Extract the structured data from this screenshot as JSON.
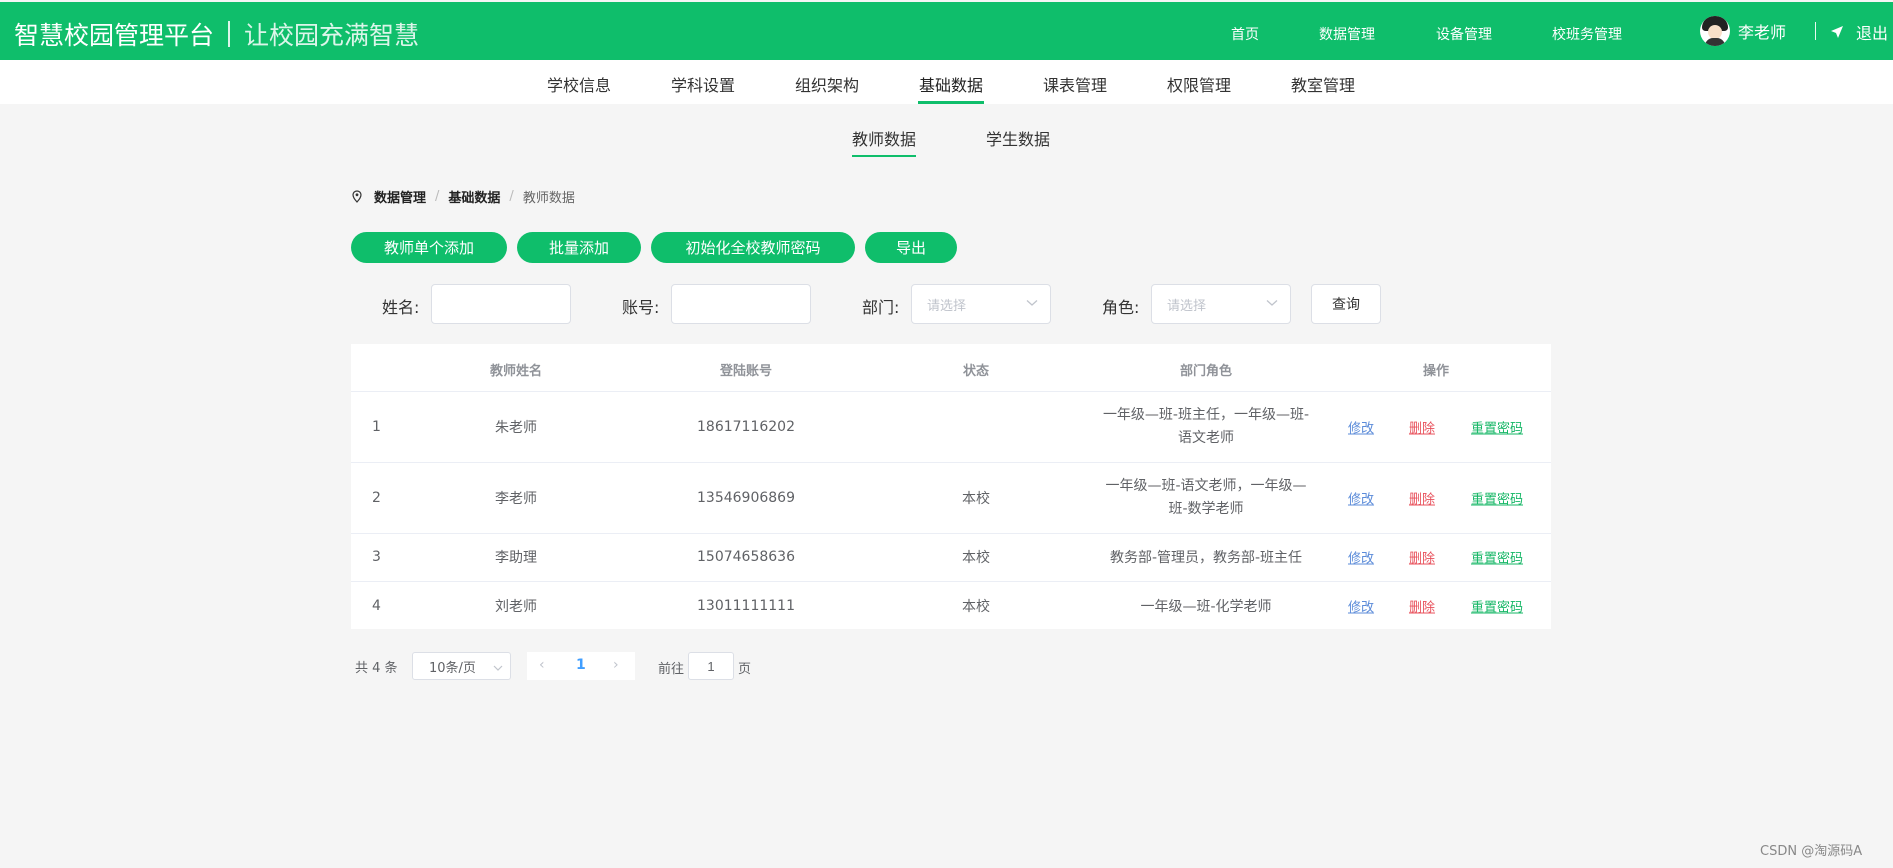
{
  "header": {
    "brand": "智慧校园管理平台",
    "slogan": "让校园充满智慧",
    "nav": [
      "首页",
      "数据管理",
      "设备管理",
      "校班务管理"
    ],
    "user_name": "李老师",
    "logout_label": "退出"
  },
  "subnav": {
    "items": [
      "学校信息",
      "学科设置",
      "组织架构",
      "基础数据",
      "课表管理",
      "权限管理",
      "教室管理"
    ],
    "active": "基础数据"
  },
  "tabs": [
    "教师数据",
    "学生数据"
  ],
  "breadcrumb": [
    "数据管理",
    "基础数据",
    "教师数据"
  ],
  "actions": [
    "教师单个添加",
    "批量添加",
    "初始化全校教师密码",
    "导出"
  ],
  "filters": {
    "name_label": "姓名:",
    "name_value": "",
    "account_label": "账号:",
    "account_value": "",
    "dept_label": "部门:",
    "dept_placeholder": "请选择",
    "role_label": "角色:",
    "role_placeholder": "请选择",
    "query_label": "查询"
  },
  "table": {
    "columns": [
      "教师姓名",
      "登陆账号",
      "状态",
      "部门角色",
      "操作"
    ],
    "rows": [
      {
        "idx": "1",
        "name": "朱老师",
        "account": "18617116202",
        "status": "",
        "roles": "一年级—班-班主任，一年级—班-语文老师"
      },
      {
        "idx": "2",
        "name": "李老师",
        "account": "13546906869",
        "status": "本校",
        "roles": "一年级—班-语文老师，一年级—班-数学老师"
      },
      {
        "idx": "3",
        "name": "李助理",
        "account": "15074658636",
        "status": "本校",
        "roles": "教务部-管理员，教务部-班主任"
      },
      {
        "idx": "4",
        "name": "刘老师",
        "account": "13011111111",
        "status": "本校",
        "roles": "一年级—班-化学老师"
      }
    ],
    "ops": {
      "edit": "修改",
      "delete": "删除",
      "reset": "重置密码"
    }
  },
  "pagination": {
    "total": "共 4 条",
    "page_size": "10条/页",
    "prev": "‹",
    "current": "1",
    "next": "›",
    "goto_label": "前往",
    "goto_value": "1",
    "page_suffix": "页"
  },
  "watermark": "CSDN @淘源码A",
  "colors": {
    "primary": "#0fbe6b",
    "edit": "#5b8bd9",
    "delete": "#e8505b",
    "reset": "#16b766"
  }
}
